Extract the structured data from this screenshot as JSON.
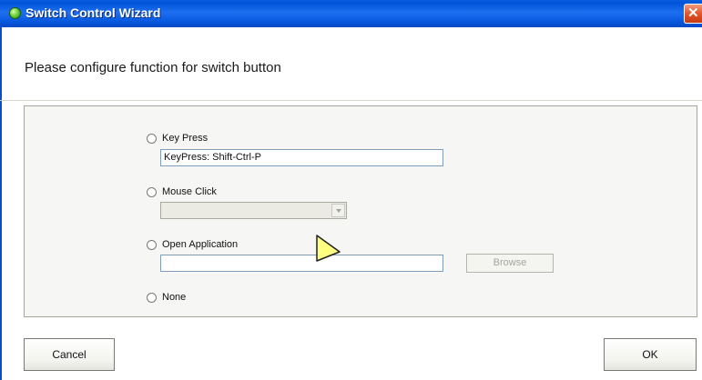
{
  "window": {
    "title": "Switch Control Wizard",
    "close_label": "✕"
  },
  "main": {
    "heading": "Please configure function for switch button"
  },
  "options": {
    "key_press": {
      "label": "Key Press",
      "value": "KeyPress: Shift-Ctrl-P"
    },
    "mouse_click": {
      "label": "Mouse Click",
      "selected": ""
    },
    "open_application": {
      "label": "Open Application",
      "value": "",
      "browse_label": "Browse"
    },
    "none": {
      "label": "None"
    }
  },
  "footer": {
    "cancel_label": "Cancel",
    "ok_label": "OK"
  },
  "colors": {
    "titlebar": "#0a5fe0",
    "close": "#e3552c",
    "cursor": "#ffff80"
  }
}
